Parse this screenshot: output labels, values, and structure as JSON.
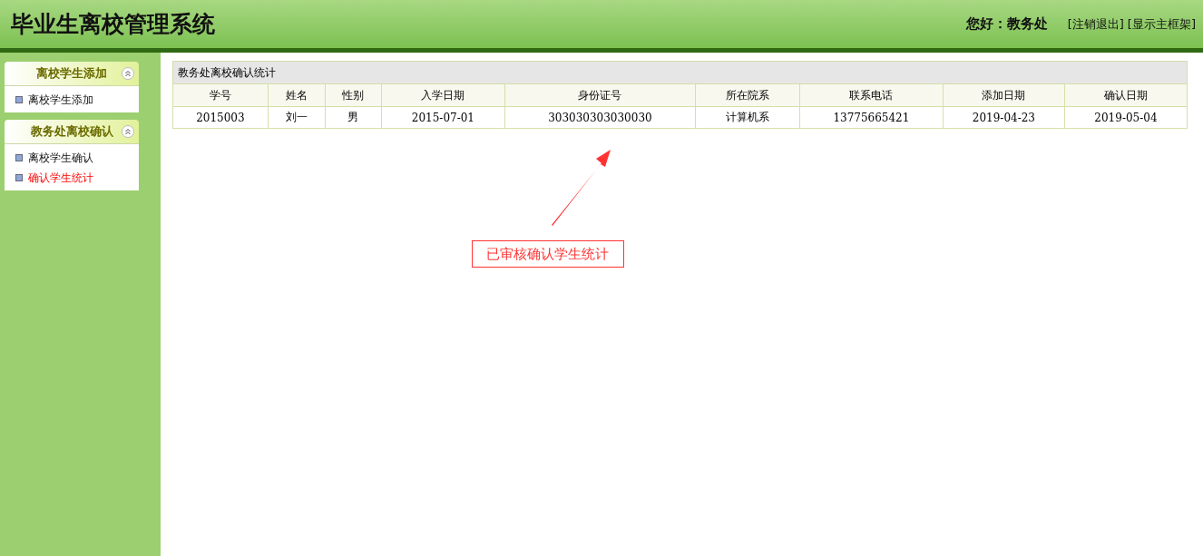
{
  "header": {
    "title": "毕业生离校管理系统",
    "greeting": "您好：教务处",
    "links": [
      "[注销退出]",
      "[显示主框架]"
    ]
  },
  "sidebar": {
    "groups": [
      {
        "title": "离校学生添加",
        "expanded": true,
        "items": [
          {
            "label": "离校学生添加",
            "selected": false
          }
        ]
      },
      {
        "title": "教务处离校确认",
        "expanded": true,
        "items": [
          {
            "label": "离校学生确认",
            "selected": false
          },
          {
            "label": "确认学生统计",
            "selected": true
          }
        ]
      }
    ]
  },
  "table": {
    "caption": "教务处离校确认统计",
    "columns": [
      "学号",
      "姓名",
      "性别",
      "入学日期",
      "身份证号",
      "所在院系",
      "联系电话",
      "添加日期",
      "确认日期"
    ],
    "rows": [
      [
        "2015003",
        "刘一",
        "男",
        "2015-07-01",
        "303030303030030",
        "计算机系",
        "13775665421",
        "2019-04-23",
        "2019-05-04"
      ]
    ]
  },
  "annotation": {
    "text": "已审核确认学生统计"
  }
}
